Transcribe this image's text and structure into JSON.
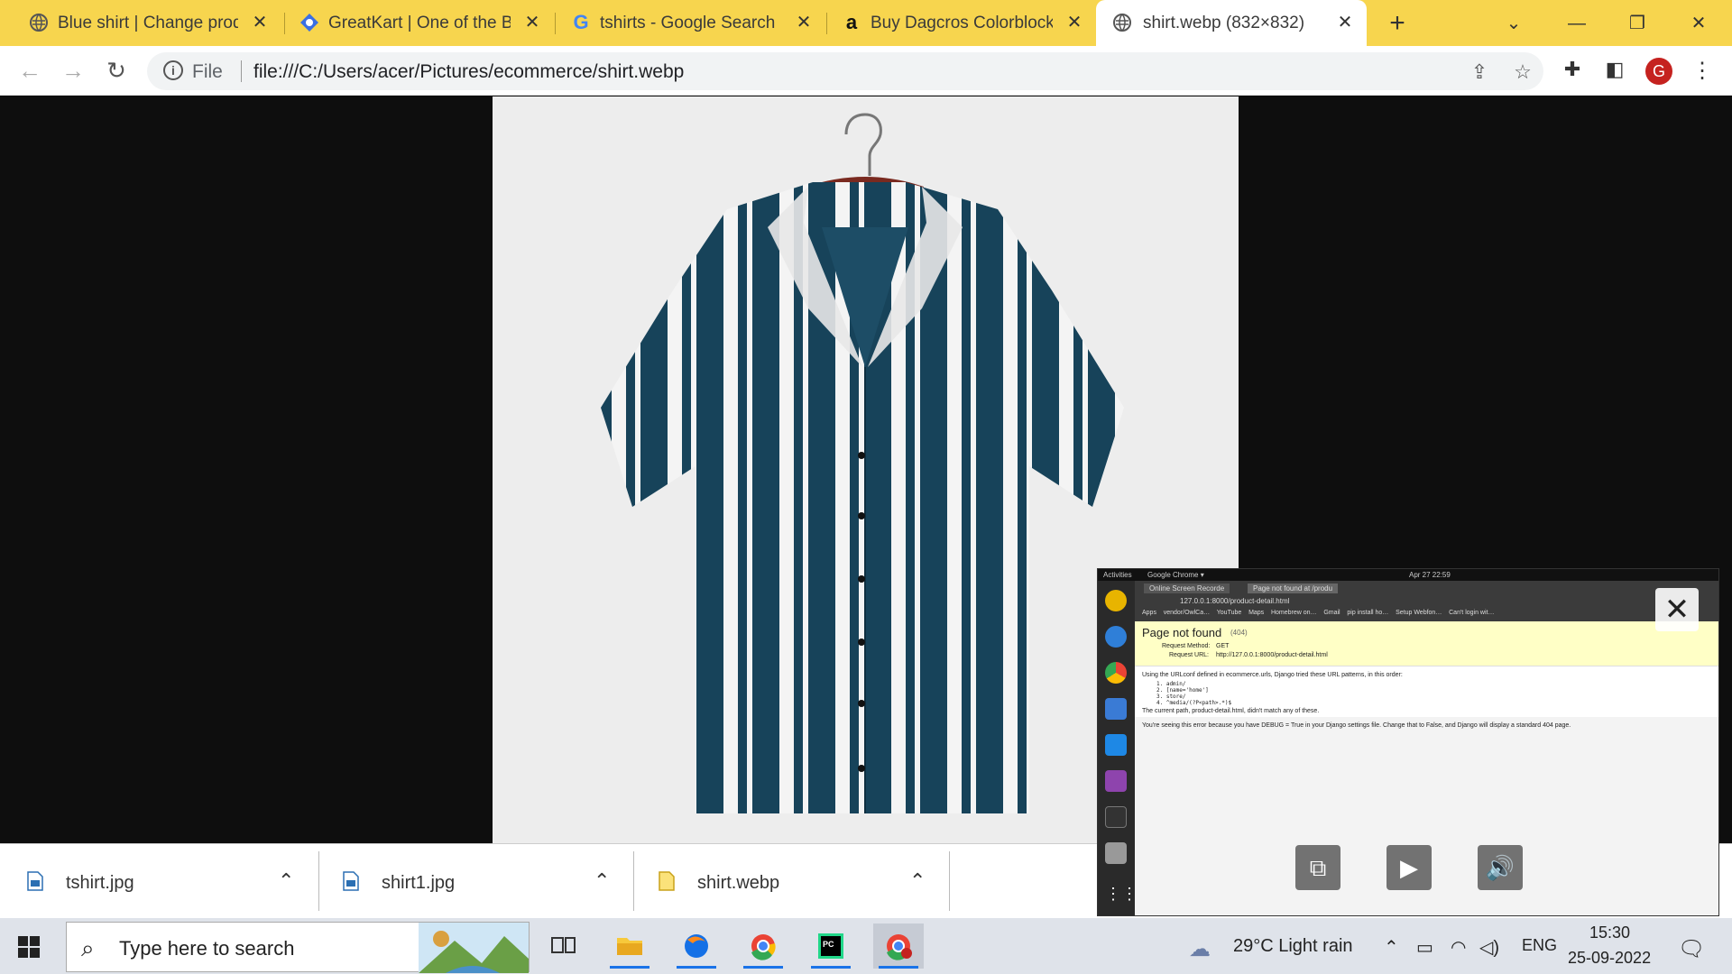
{
  "browser": {
    "tabs": [
      {
        "title": "Blue shirt | Change produ",
        "icon": "globe-icon"
      },
      {
        "title": "GreatKart | One of the Big",
        "icon": "greatkart-icon"
      },
      {
        "title": "tshirts - Google Search",
        "icon": "google-icon"
      },
      {
        "title": "Buy Dagcros Colorblock T",
        "icon": "amazon-icon"
      },
      {
        "title": "shirt.webp (832×832)",
        "icon": "globe-icon"
      }
    ],
    "address": {
      "scheme": "File",
      "url": "file:///C:/Users/acer/Pictures/ecommerce/shirt.webp"
    },
    "profile_initial": "G"
  },
  "downloads": [
    {
      "name": "tshirt.jpg"
    },
    {
      "name": "shirt1.jpg"
    },
    {
      "name": "shirt.webp"
    }
  ],
  "pip": {
    "topbar": {
      "activities": "Activities",
      "app": "Google Chrome ▾",
      "clock": "Apr 27  22:59"
    },
    "tabs": [
      "Online Screen Recorde",
      "Page not found at /produ"
    ],
    "url": "127.0.0.1:8000/product-detail.html",
    "bookmarks": [
      "Apps",
      "vendor/OwlCa…",
      "YouTube",
      "Maps",
      "Homebrew on…",
      "Gmail",
      "pip install ho…",
      "Setup Webfon…",
      "Can't login wit…"
    ],
    "error_title": "Page not found",
    "error_code": "(404)",
    "request_method_label": "Request Method:",
    "request_method": "GET",
    "request_url_label": "Request URL:",
    "request_url": "http://127.0.0.1:8000/product-detail.html",
    "body_line1": "Using the URLconf defined in ecommerce.urls, Django tried these URL patterns, in this order:",
    "patterns": [
      "1. admin/",
      "2. [name='home']",
      "3. store/",
      "4. ^media/(?P<path>.*)$"
    ],
    "body_line2": "The current path, product-detail.html, didn't match any of these.",
    "body_line3": "You're seeing this error because you have DEBUG = True in your Django settings file. Change that to False, and Django will display a standard 404 page."
  },
  "taskbar": {
    "search_placeholder": "Type here to search",
    "weather": "29°C  Light rain",
    "language": "ENG",
    "time": "15:30",
    "date": "25-09-2022"
  }
}
